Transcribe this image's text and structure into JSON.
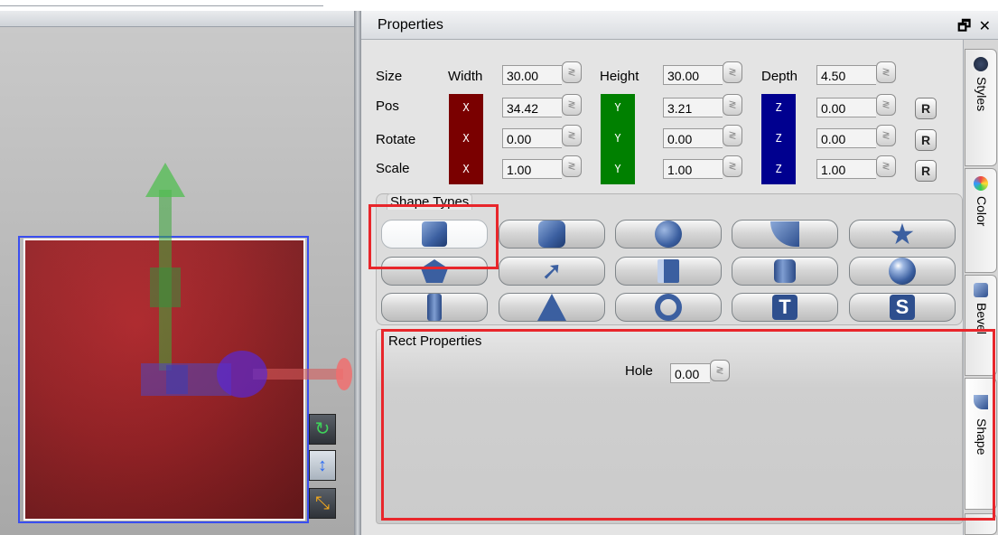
{
  "panel": {
    "title": "Properties",
    "window_controls": "🗗 ✕"
  },
  "transform": {
    "row_labels": {
      "size": "Size",
      "pos": "Pos",
      "rotate": "Rotate",
      "scale": "Scale"
    },
    "column_labels": {
      "width": "Width",
      "height": "Height",
      "depth": "Depth"
    },
    "axis_letters": {
      "x": "X",
      "y": "Y",
      "z": "Z"
    },
    "reset_label": "R",
    "size": {
      "width": "30.00",
      "height": "30.00",
      "depth": "4.50"
    },
    "pos": {
      "x": "34.42",
      "y": "3.21",
      "z": "0.00"
    },
    "rotate": {
      "x": "0.00",
      "y": "0.00",
      "z": "0.00"
    },
    "scale": {
      "x": "1.00",
      "y": "1.00",
      "z": "1.00"
    },
    "spinner_glyph": "≷"
  },
  "shape_types": {
    "title": "Shape Types",
    "selected": "square"
  },
  "rect_properties": {
    "title": "Rect Properties",
    "hole_label": "Hole",
    "hole_value": "0.00"
  },
  "side_tabs": [
    {
      "label": "Styles"
    },
    {
      "label": "Color"
    },
    {
      "label": "Bevel"
    },
    {
      "label": "Shape"
    }
  ],
  "colors": {
    "axis_x": "#7a0000",
    "axis_y": "#008000",
    "axis_z": "#00008f",
    "shape_red": "#9a2024",
    "highlight": "#e8262b"
  }
}
